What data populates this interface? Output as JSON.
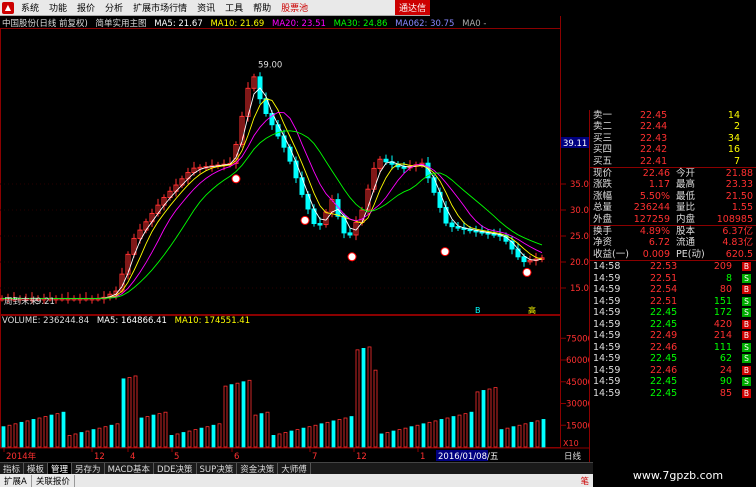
{
  "menu": {
    "items": [
      "系统",
      "功能",
      "报价",
      "分析",
      "扩展市场行情",
      "资讯",
      "工具",
      "帮助"
    ],
    "highlight": "股票池",
    "corner": "通达信"
  },
  "price_panel": {
    "title": "中国股份(日线 前复权)",
    "template": "简单实用主图",
    "ma_labels": [
      "MA5: 21.67",
      "MA10: 21.69",
      "MA20: 23.51",
      "MA30: 24.86",
      "MA062: 30.75",
      "MA0 -"
    ],
    "ma_colors": [
      "#ffffff",
      "#ffff00",
      "#ff00ff",
      "#00ff00",
      "#8888ff",
      "#aaaaaa"
    ],
    "high_label": "59.00",
    "axis_labels": [
      "39.11",
      "35.00",
      "30.00",
      "25.00",
      "20.00",
      "15.00"
    ],
    "current_price_tag": "39.11",
    "left_label": "周到末来",
    "left_price": "9.21",
    "markers": [
      "B",
      "高"
    ],
    "watermark_url": "www.7gpzb.com"
  },
  "volume_panel": {
    "header": "VOLUME: 236244.84",
    "ma_labels": [
      "MA5: 164866.41",
      "MA10: 174551.41"
    ],
    "axis_labels": [
      "75000",
      "60000",
      "45000",
      "30000",
      "15000"
    ],
    "unit": "X10"
  },
  "xaxis": {
    "labels": [
      "2014年",
      "12",
      "4",
      "5",
      "6",
      "7",
      "12",
      "1"
    ],
    "date_box": "2016/01/08/五",
    "right_label": "日线"
  },
  "quote": {
    "asks": [
      {
        "label": "卖一",
        "price": "22.45",
        "vol": "14"
      },
      {
        "label": "卖二",
        "price": "22.44",
        "vol": "2"
      },
      {
        "label": "买三",
        "price": "22.43",
        "vol": "34"
      },
      {
        "label": "买四",
        "price": "22.42",
        "vol": "16"
      },
      {
        "label": "买五",
        "price": "22.41",
        "vol": "7"
      }
    ],
    "stats": [
      {
        "l1": "现价",
        "v1": "22.46",
        "l2": "今开",
        "v2": "21.88"
      },
      {
        "l1": "涨跌",
        "v1": "1.17",
        "l2": "最高",
        "v2": "23.33"
      },
      {
        "l1": "涨幅",
        "v1": "5.50%",
        "l2": "最低",
        "v2": "21.50"
      },
      {
        "l1": "总量",
        "v1": "236244",
        "l2": "量比",
        "v2": "1.55"
      },
      {
        "l1": "外盘",
        "v1": "127259",
        "l2": "内盘",
        "v2": "108985"
      }
    ],
    "stats2": [
      {
        "l1": "换手",
        "v1": "4.89%",
        "l2": "股本",
        "v2": "6.37亿"
      },
      {
        "l1": "净资",
        "v1": "6.72",
        "l2": "流通",
        "v2": "4.83亿"
      },
      {
        "l1": "收益(一)",
        "v1": "0.009",
        "l2": "PE(动)",
        "v2": "620.5"
      }
    ],
    "ticks": [
      {
        "t": "14:58",
        "p": "22.53",
        "v": "209",
        "d": "B"
      },
      {
        "t": "14:59",
        "p": "22.51",
        "v": "8",
        "d": "S"
      },
      {
        "t": "14:59",
        "p": "22.54",
        "v": "80",
        "d": "B"
      },
      {
        "t": "14:59",
        "p": "22.51",
        "v": "151",
        "d": "S"
      },
      {
        "t": "14:59",
        "p": "22.45",
        "v": "172",
        "d": "S"
      },
      {
        "t": "14:59",
        "p": "22.45",
        "v": "420",
        "d": "B"
      },
      {
        "t": "14:59",
        "p": "22.49",
        "v": "214",
        "d": "B"
      },
      {
        "t": "14:59",
        "p": "22.46",
        "v": "111",
        "d": "S"
      },
      {
        "t": "14:59",
        "p": "22.45",
        "v": "62",
        "d": "S"
      },
      {
        "t": "14:59",
        "p": "22.46",
        "v": "24",
        "d": "B"
      },
      {
        "t": "14:59",
        "p": "22.45",
        "v": "90",
        "d": "S"
      },
      {
        "t": "14:59",
        "p": "22.45",
        "v": "85",
        "d": "B"
      }
    ]
  },
  "tabs": [
    "指标",
    "模板",
    "管理",
    "另存为",
    "MACD基本",
    "DDE决策",
    "SUP决策",
    "资金决策",
    "大师傅"
  ],
  "active_tab": "管理",
  "status": [
    "扩展A",
    "关联报价"
  ],
  "status_right": "笔",
  "site_watermark": "www.7gpzb.com",
  "colors": {
    "up": "#ff3030",
    "down": "#00ffff",
    "grid": "#8b0000",
    "bg": "#000000"
  }
}
